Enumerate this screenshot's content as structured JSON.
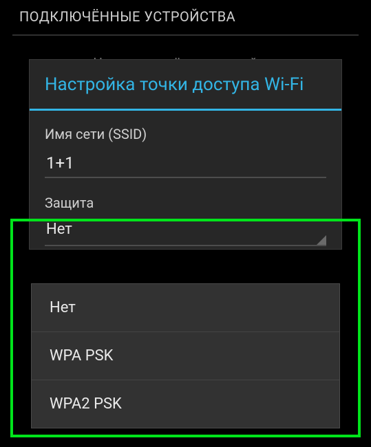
{
  "header": {
    "title": "ПОДКЛЮЧЁННЫЕ УСТРОЙСТВА"
  },
  "background": {
    "empty_text": "Нет подключённых устройств"
  },
  "modal": {
    "title": "Настройка точки доступа Wi-Fi",
    "ssid": {
      "label": "Имя сети (SSID)",
      "value": "1+1"
    },
    "security": {
      "label": "Защита",
      "selected": "Нет",
      "options": [
        "Нет",
        "WPA PSK",
        "WPA2 PSK"
      ]
    }
  }
}
